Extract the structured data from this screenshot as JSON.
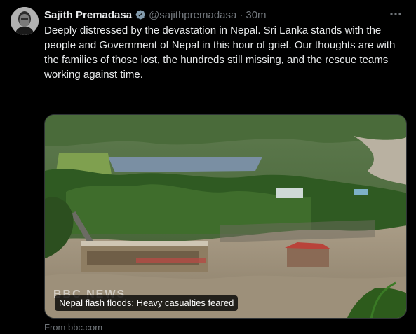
{
  "tweet": {
    "author_name": "Sajith Premadasa",
    "handle": "@sajithpremadasa",
    "separator": "·",
    "time": "30m",
    "verified": true,
    "text": "Deeply distressed by the devastation in Nepal. Sri Lanka stands with the people and Government of Nepal in this hour of grief. Our thoughts are with the families of those lost, the hundreds still missing, and the rescue teams working against time."
  },
  "media": {
    "caption": "Nepal flash floods: Heavy casualties feared",
    "source": "From bbc.com",
    "watermark": "BBC NEWS"
  },
  "icons": {
    "verified": "verified-badge-icon",
    "more": "more-options-icon"
  },
  "colors": {
    "background": "#000000",
    "text": "#e7e9ea",
    "muted": "#71767b",
    "verified": "#829aab"
  }
}
